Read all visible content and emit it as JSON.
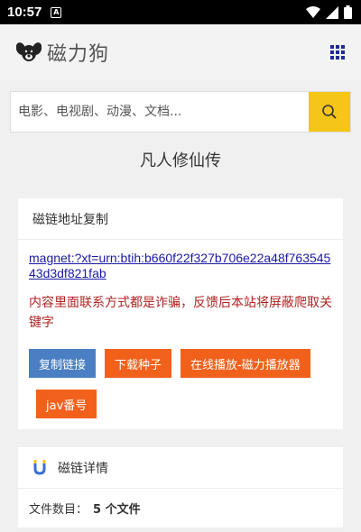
{
  "status": {
    "time": "10:57",
    "notif_letter": "A"
  },
  "header": {
    "logo_text": "磁力狗"
  },
  "search": {
    "placeholder": "电影、电视剧、动漫、文档..."
  },
  "page_title": "凡人修仙传",
  "magnet_card": {
    "title": "磁链地址复制",
    "link": "magnet:?xt=urn:btih:b660f22f327b706e22a48f76354543d3df821fab",
    "warning": "内容里面联系方式都是诈骗，反馈后本站将屏蔽爬取关键字",
    "buttons": {
      "copy": "复制链接",
      "download": "下载种子",
      "play": "在线播放-磁力播放器",
      "jav": "jav番号"
    }
  },
  "details_card": {
    "title": "磁链详情",
    "file_count_label": "文件数目：",
    "file_count_value": "5 个文件"
  },
  "colors": {
    "accent": "#f5c518",
    "blue_btn": "#4a7fc3",
    "orange_btn": "#f2611c",
    "warning": "#b22222"
  }
}
